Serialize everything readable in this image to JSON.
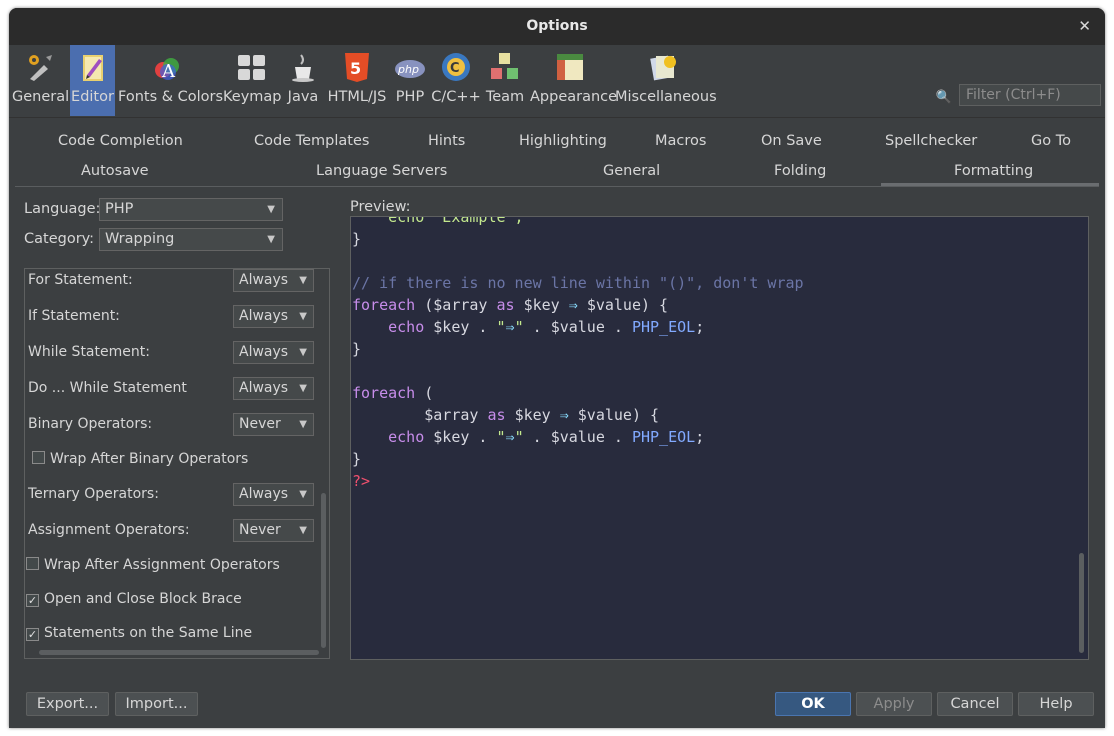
{
  "window": {
    "title": "Options"
  },
  "toolbar": {
    "items": [
      {
        "label": "General",
        "icon": "general-tools-icon"
      },
      {
        "label": "Editor",
        "icon": "editor-pencil-icon",
        "selected": true
      },
      {
        "label": "Fonts & Colors",
        "icon": "fonts-colors-icon"
      },
      {
        "label": "Keymap",
        "icon": "keymap-icon"
      },
      {
        "label": "Java",
        "icon": "java-cup-icon"
      },
      {
        "label": "HTML/JS",
        "icon": "html5-icon"
      },
      {
        "label": "PHP",
        "icon": "php-icon"
      },
      {
        "label": "C/C++",
        "icon": "cpp-icon"
      },
      {
        "label": "Team",
        "icon": "team-cubes-icon"
      },
      {
        "label": "Appearance",
        "icon": "appearance-icon"
      },
      {
        "label": "Miscellaneous",
        "icon": "miscellaneous-icon"
      }
    ],
    "filter_placeholder": "Filter (Ctrl+F)"
  },
  "tabs": {
    "row1": [
      "Code Completion",
      "Code Templates",
      "Hints",
      "Highlighting",
      "Macros",
      "On Save",
      "Spellchecker",
      "Go To"
    ],
    "row2": [
      "Autosave",
      "Language Servers",
      "General",
      "Folding",
      "Formatting"
    ],
    "active": "Formatting"
  },
  "left": {
    "language_label": "Language:",
    "language_value": "PHP",
    "category_label": "Category:",
    "category_value": "Wrapping",
    "options": [
      {
        "label": "For Statement:",
        "value": "Always"
      },
      {
        "label": "If Statement:",
        "value": "Always"
      },
      {
        "label": "While Statement:",
        "value": "Always"
      },
      {
        "label": "Do ... While Statement",
        "value": "Always"
      },
      {
        "label": "Binary Operators:",
        "value": "Never"
      },
      {
        "label": "Wrap After Binary Operators",
        "checked": false
      },
      {
        "label": "Ternary Operators:",
        "value": "Always"
      },
      {
        "label": "Assignment Operators:",
        "value": "Never"
      },
      {
        "label": "Wrap After Assignment Operators",
        "checked": false
      },
      {
        "label": "Open and Close Block Brace",
        "checked": true
      },
      {
        "label": "Statements on the Same Line",
        "checked": true
      }
    ]
  },
  "preview": {
    "label": "Preview:",
    "code": {
      "partial_line": "    echo \"Example\";",
      "brace": "}",
      "comment": "// if there is no new line within \"()\", don't wrap",
      "kw_foreach": "foreach",
      "kw_as": "as",
      "kw_echo": "echo",
      "var_array": "$array",
      "var_key": "$key",
      "var_value": "$value",
      "arrow": "⇒",
      "const_eol": "PHP_EOL",
      "close_tag": "?>"
    }
  },
  "buttons": {
    "export": "Export...",
    "import": "Import...",
    "ok": "OK",
    "apply": "Apply",
    "cancel": "Cancel",
    "help": "Help"
  }
}
